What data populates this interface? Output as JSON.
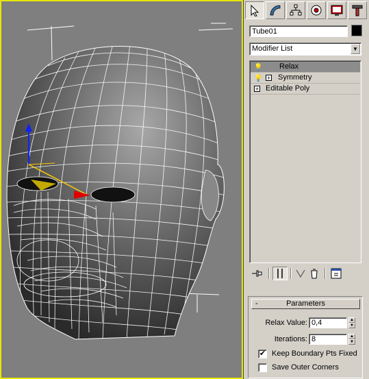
{
  "command_panel": {
    "tabs": [
      {
        "name": "create-icon",
        "active": true
      },
      {
        "name": "modify-icon",
        "active": false
      },
      {
        "name": "hierarchy-icon",
        "active": false
      },
      {
        "name": "motion-icon",
        "active": false
      },
      {
        "name": "display-icon",
        "active": false
      },
      {
        "name": "utilities-icon",
        "active": false
      }
    ],
    "object_name": "Tube01",
    "object_color": "#000000",
    "modifier_list_label": "Modifier List",
    "stack": [
      {
        "label": "Relax",
        "selected": true,
        "bulb": true,
        "expand": false
      },
      {
        "label": "Symmetry",
        "selected": false,
        "bulb": true,
        "expand": true
      },
      {
        "label": "Editable Poly",
        "selected": false,
        "bulb": false,
        "expand": true
      }
    ],
    "stack_tools": [
      "pin-stack-icon",
      "show-end-result-icon",
      "make-unique-icon",
      "remove-modifier-icon",
      "configure-sets-icon"
    ]
  },
  "parameters": {
    "title": "Parameters",
    "collapse_symbol": "-",
    "relax_value_label": "Relax Value:",
    "relax_value": "0,4",
    "iterations_label": "Iterations:",
    "iterations": "8",
    "keep_boundary_label": "Keep Boundary Pts Fixed",
    "keep_boundary_checked": true,
    "save_outer_label": "Save Outer Corners",
    "save_outer_checked": false
  },
  "colors": {
    "viewport_bg": "#7f7f7f",
    "active_viewport_border": "#e8e800",
    "panel_bg": "#d4d0c8",
    "selected_row": "#8c8c8c"
  }
}
